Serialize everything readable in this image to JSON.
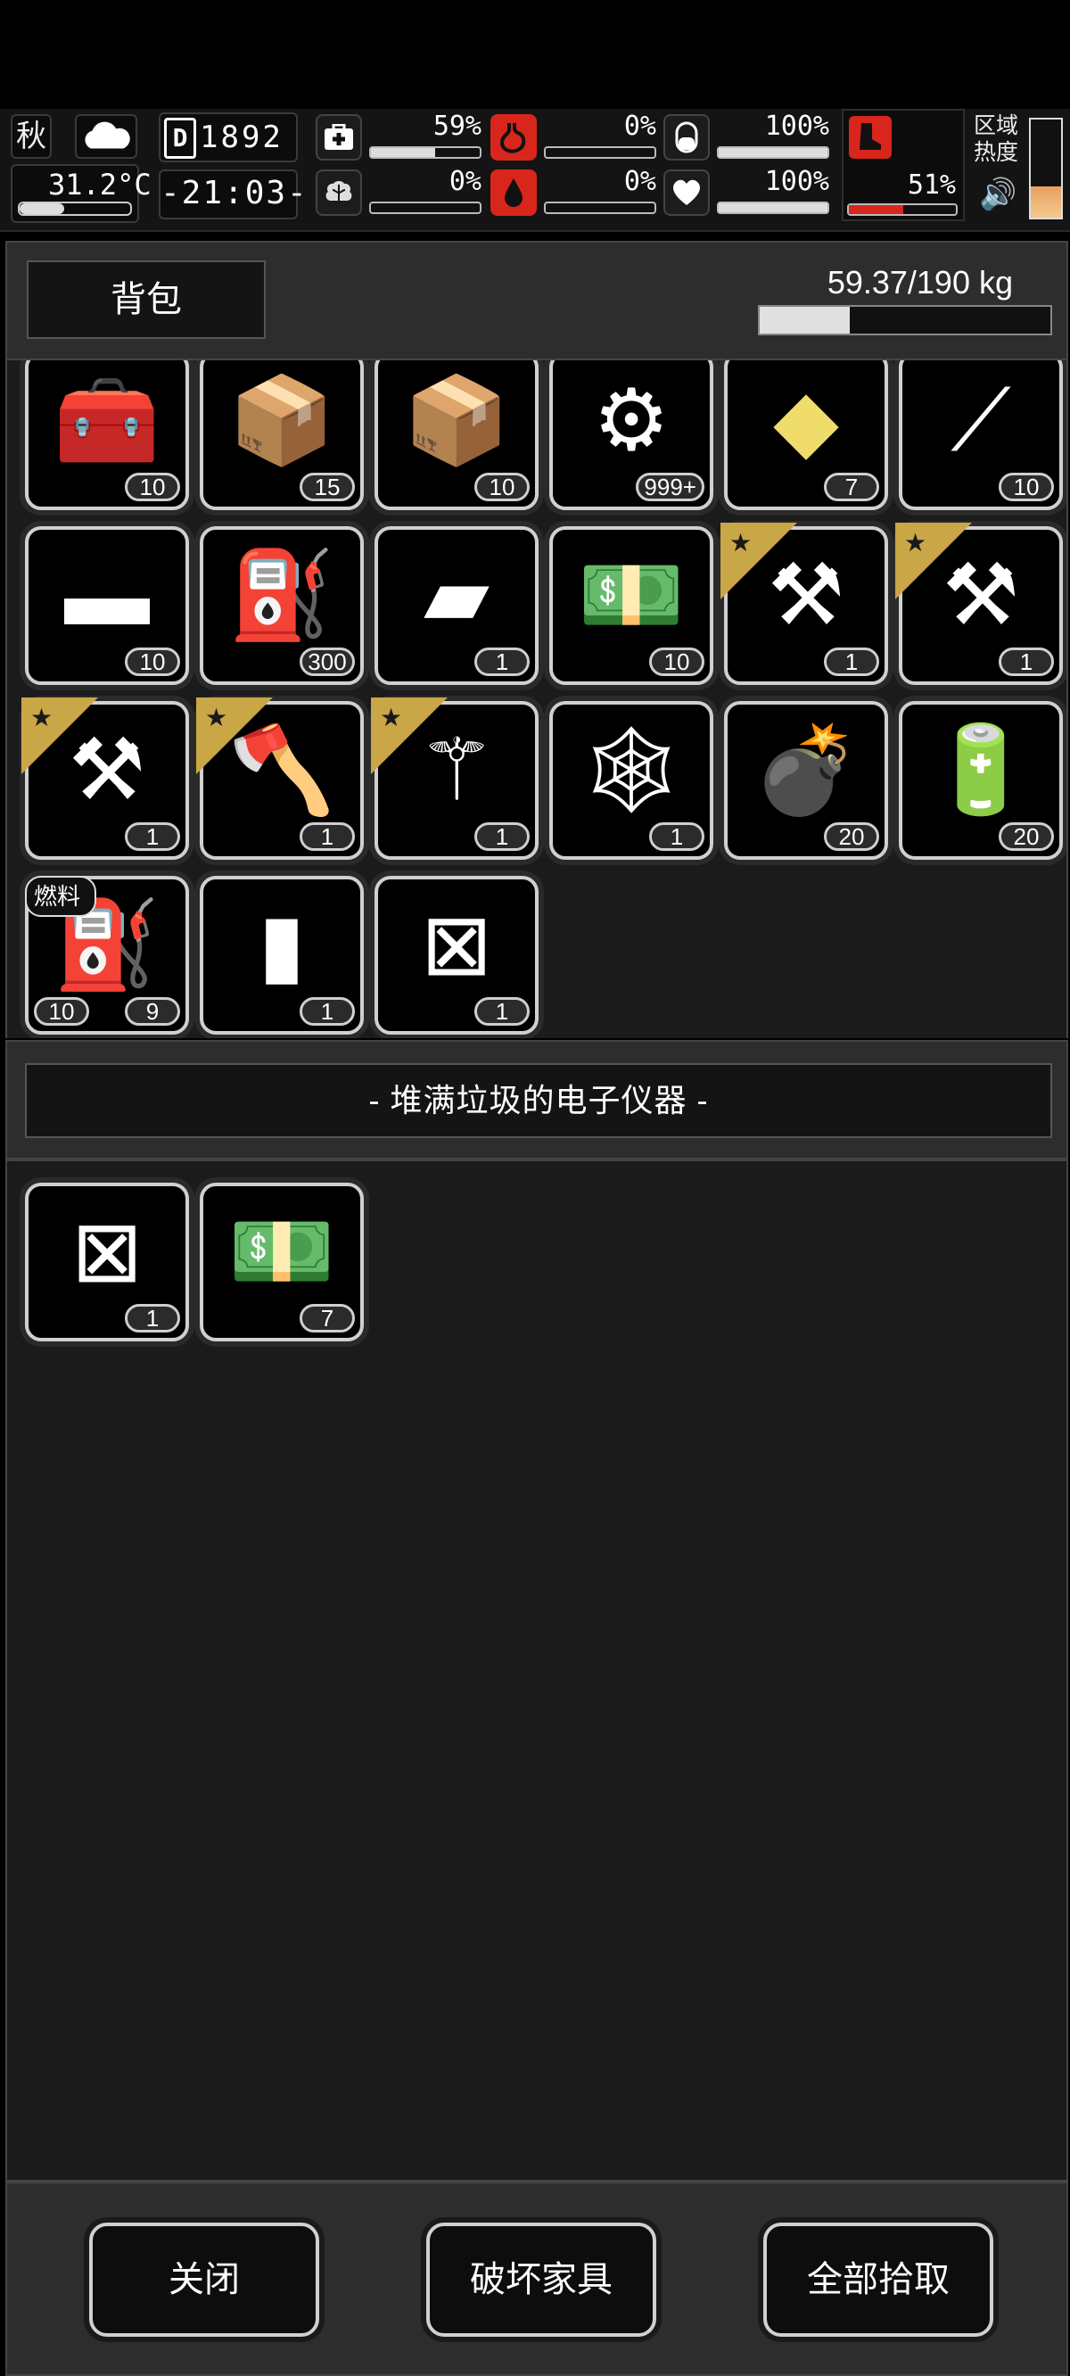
{
  "status": {
    "season": "秋",
    "weather_icon": "cloud-icon",
    "temperature": "31.2°C",
    "day_icon_letter": "D",
    "day": "1892",
    "time": "-21:03-",
    "stats": [
      {
        "name": "health",
        "icon": "medkit-icon",
        "value": "59%",
        "level": 0.59,
        "alert": false
      },
      {
        "name": "hunger",
        "icon": "stomach-icon",
        "value": "0%",
        "level": 0.0,
        "alert": true
      },
      {
        "name": "thirst-pill",
        "icon": "pill-icon",
        "value": "100%",
        "level": 1.0,
        "alert": false
      },
      {
        "name": "sanity",
        "icon": "brain-icon",
        "value": "0%",
        "level": 0.0,
        "alert": false
      },
      {
        "name": "thirst",
        "icon": "water-drop-icon",
        "value": "0%",
        "level": 0.0,
        "alert": true
      },
      {
        "name": "mood",
        "icon": "heart-icon",
        "value": "100%",
        "level": 1.0,
        "alert": false
      }
    ],
    "boot": {
      "icon": "boot-icon",
      "value": "51%",
      "level": 0.51
    },
    "area_label_1": "区域",
    "area_label_2": "热度",
    "area_heat_level": 0.32
  },
  "bag": {
    "title": "背包",
    "weight": "59.37/190 kg",
    "weight_ratio": 0.31
  },
  "inventory": [
    {
      "icon": "toolbag-icon",
      "glyph": "🧰",
      "count": "10"
    },
    {
      "icon": "crate-icon",
      "glyph": "📦",
      "count": "15"
    },
    {
      "icon": "crate-gear-icon",
      "glyph": "📦",
      "count": "10"
    },
    {
      "icon": "parts-coin-icon",
      "glyph": "⚙",
      "count": "999+"
    },
    {
      "icon": "gold-crystal-icon",
      "glyph": "◆",
      "count": "7",
      "gold": true
    },
    {
      "icon": "tweezers-icon",
      "glyph": "⟋",
      "count": "10"
    },
    {
      "icon": "bandage-roll-icon",
      "glyph": "▬",
      "count": "10"
    },
    {
      "icon": "fuel-can-icon",
      "glyph": "⛽",
      "count": "300"
    },
    {
      "icon": "metal-ingot-icon",
      "glyph": "▰",
      "count": "1"
    },
    {
      "icon": "cash-bundle-icon",
      "glyph": "💵",
      "count": "10"
    },
    {
      "icon": "chainsaw-icon",
      "glyph": "⚒",
      "count": "1",
      "starred": true
    },
    {
      "icon": "chainsaw-icon",
      "glyph": "⚒",
      "count": "1",
      "starred": true
    },
    {
      "icon": "chainsaw-icon",
      "glyph": "⚒",
      "count": "1",
      "starred": true
    },
    {
      "icon": "axe-icon",
      "glyph": "🪓",
      "count": "1",
      "starred": true
    },
    {
      "icon": "shovel-icon",
      "glyph": "⚚",
      "count": "1",
      "starred": true
    },
    {
      "icon": "net-icon",
      "glyph": "🕸",
      "count": "1"
    },
    {
      "icon": "grenade-icon",
      "glyph": "💣",
      "count": "20"
    },
    {
      "icon": "battery-icon",
      "glyph": "🔋",
      "count": "20"
    },
    {
      "icon": "fuel-tank-icon",
      "glyph": "⛽",
      "count": "9",
      "count2": "10",
      "tag": "燃料"
    },
    {
      "icon": "tube-icon",
      "glyph": "▮",
      "count": "1"
    },
    {
      "icon": "broken-part-icon",
      "glyph": "⊠",
      "count": "1"
    }
  ],
  "container": {
    "title": "- 堆满垃圾的电子仪器 -",
    "items": [
      {
        "icon": "broken-part-icon",
        "glyph": "⊠",
        "count": "1"
      },
      {
        "icon": "cash-bundle-icon",
        "glyph": "💵",
        "count": "7"
      }
    ]
  },
  "footer": {
    "close": "关闭",
    "destroy": "破坏家具",
    "take_all": "全部拾取"
  }
}
